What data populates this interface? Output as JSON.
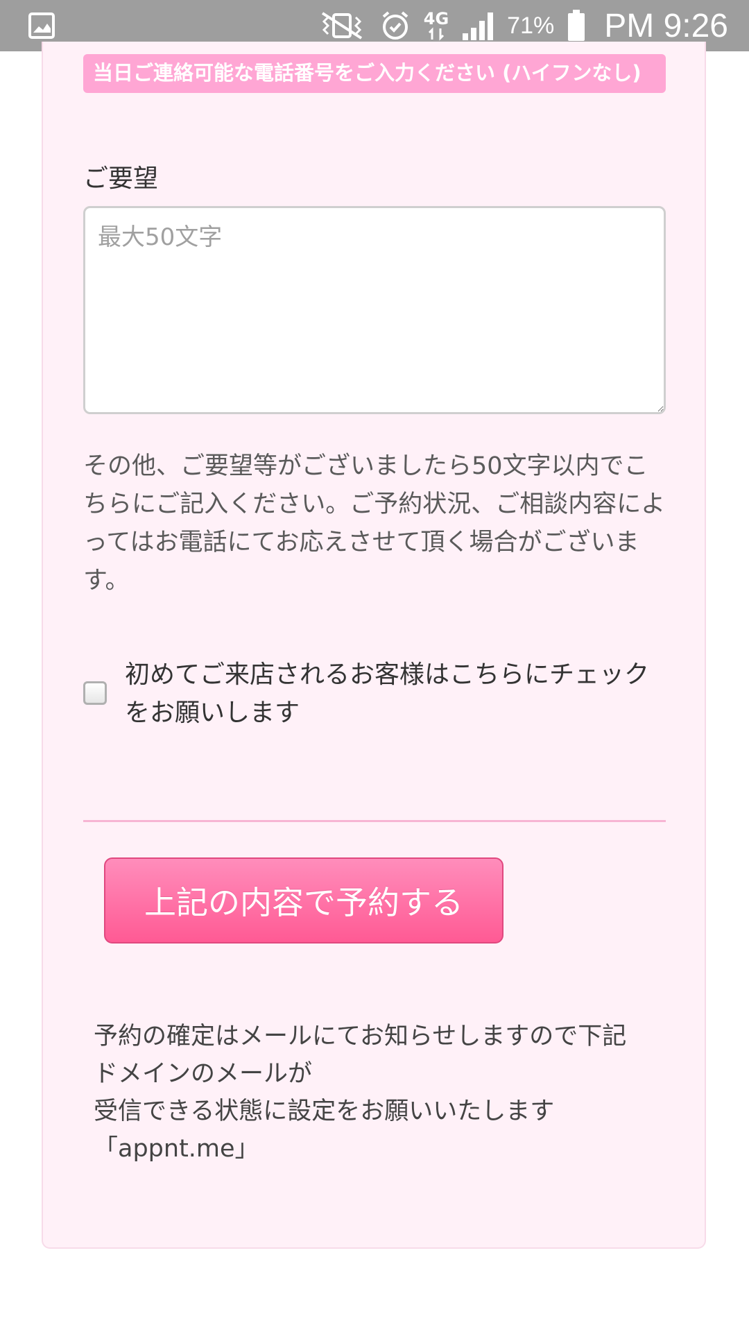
{
  "status_bar": {
    "network": "4G",
    "battery": "71%",
    "time": "PM 9:26"
  },
  "phone_hint": "当日ご連絡可能な電話番号をご入力ください (ハイフンなし)",
  "request": {
    "label": "ご要望",
    "placeholder": "最大50文字",
    "value": "",
    "help": "その他、ご要望等がございましたら50文字以内でこちらにご記入ください。ご予約状況、ご相談内容によってはお電話にてお応えさせて頂く場合がございます。"
  },
  "first_visit": {
    "label": "初めてご来店されるお客様はこちらにチェックをお願いします",
    "checked": false
  },
  "submit_label": "上記の内容で予約する",
  "confirm_note": {
    "line1": "予約の確定はメールにてお知らせしますので下記",
    "line2": "ドメインのメールが",
    "line3": "受信できる状態に設定をお願いいたします",
    "line4": "「appnt.me」"
  }
}
